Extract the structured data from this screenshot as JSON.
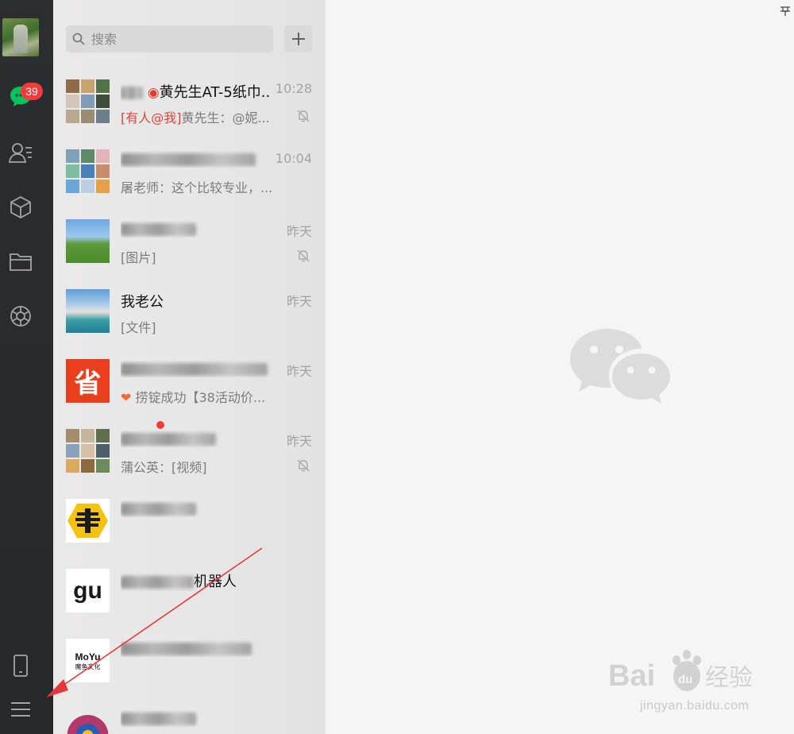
{
  "nav": {
    "unread_count": "39",
    "items": [
      "chat-icon",
      "contacts-icon",
      "favorites-icon",
      "files-icon",
      "moments-icon",
      "phone-icon",
      "menu-icon"
    ]
  },
  "search": {
    "placeholder": "搜索",
    "add_icon": "plus-icon"
  },
  "chats": [
    {
      "name_visible": "黄先生AT-5纸巾...",
      "preview_mention": "[有人@我]",
      "preview": "黄先生：@妮...",
      "time": "10:28",
      "muted": true
    },
    {
      "name_visible": "",
      "preview_mention": "",
      "preview": "屠老师：这个比较专业，...",
      "time": "10:04",
      "muted": false
    },
    {
      "name_visible": "",
      "preview_mention": "",
      "preview": "[图片]",
      "time": "昨天",
      "muted": true
    },
    {
      "name_visible": "我老公",
      "preview_mention": "",
      "preview": "[文件]",
      "time": "昨天",
      "muted": false
    },
    {
      "name_visible": "",
      "preview_mention": "",
      "preview": "捞锭成功【38活动价...",
      "time": "昨天",
      "muted": false
    },
    {
      "name_visible": "",
      "preview_mention": "",
      "preview": "蒲公英：[视频]",
      "time": "昨天",
      "muted": true
    },
    {
      "name_visible": "",
      "preview_mention": "",
      "preview": "",
      "time": "",
      "muted": false
    },
    {
      "name_visible": "机器人",
      "preview_mention": "",
      "preview": "",
      "time": "",
      "muted": false
    },
    {
      "name_visible": "",
      "preview_mention": "",
      "preview": "",
      "time": "",
      "muted": false
    },
    {
      "name_visible": "",
      "preview_mention": "",
      "preview": "",
      "time": "",
      "muted": false
    }
  ],
  "thumbs": {
    "sheng_char": "省",
    "moyu_title": "MoYu",
    "moyu_sub": "魔鱼文化",
    "gu_text": "gu"
  },
  "window": {
    "pin_icon": "pin-icon"
  },
  "watermark": {
    "brand": "Bai du 经验",
    "url": "jingyan.baidu.com"
  },
  "colors": {
    "accent_green": "#07c160",
    "badge_red": "#f23b3b",
    "mention_red": "#e0433c"
  }
}
